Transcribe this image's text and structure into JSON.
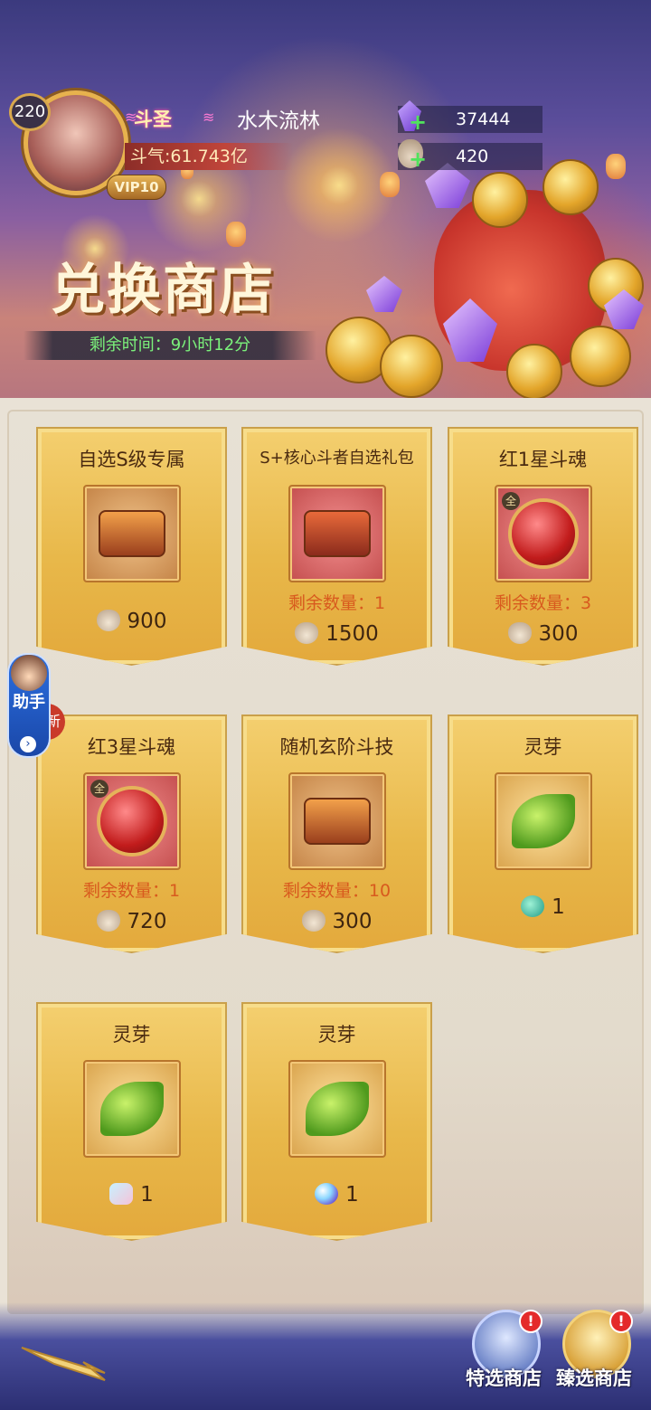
{
  "player": {
    "level": "220",
    "vip": "VIP10",
    "rank": "斗圣",
    "name": "水木流林",
    "power": "斗气:61.743亿"
  },
  "currencies": [
    {
      "icon": "purple-crystal-icon",
      "value": "37444"
    },
    {
      "icon": "coin-bag-icon",
      "value": "420"
    }
  ],
  "banner": {
    "title": "兑换商店",
    "timer": "剩余时间：9小时12分"
  },
  "items": [
    {
      "name": "自选S级专属",
      "remain": "",
      "price": "900",
      "currency": "coin-bag-icon",
      "art": "treasure-chest-icon"
    },
    {
      "name": "S+核心斗者自选礼包",
      "remain": "剩余数量：1",
      "price": "1500",
      "currency": "coin-bag-icon",
      "art": "s-plus-chest-icon"
    },
    {
      "name": "红1星斗魂",
      "remain": "剩余数量：3",
      "price": "300",
      "currency": "coin-bag-icon",
      "art": "red-soul-orb-icon"
    },
    {
      "name": "红3星斗魂",
      "remain": "剩余数量：1",
      "price": "720",
      "currency": "coin-bag-icon",
      "art": "red-soul-orb-icon"
    },
    {
      "name": "随机玄阶斗技",
      "remain": "剩余数量：10",
      "price": "300",
      "currency": "coin-bag-icon",
      "art": "skill-chest-icon"
    },
    {
      "name": "灵芽",
      "remain": "",
      "price": "1",
      "currency": "jade-icon",
      "art": "spirit-sprout-icon"
    },
    {
      "name": "灵芽",
      "remain": "",
      "price": "1",
      "currency": "pouch-icon",
      "art": "spirit-sprout-icon"
    },
    {
      "name": "灵芽",
      "remain": "",
      "price": "1",
      "currency": "orb-icon",
      "art": "spirit-sprout-icon"
    }
  ],
  "all_tag": "全",
  "assistant": {
    "label": "助手",
    "arrow": "›",
    "new_tag": "新"
  },
  "nav": {
    "special_shop": "特选商店",
    "premium_shop": "臻选商店",
    "alert": "!"
  }
}
